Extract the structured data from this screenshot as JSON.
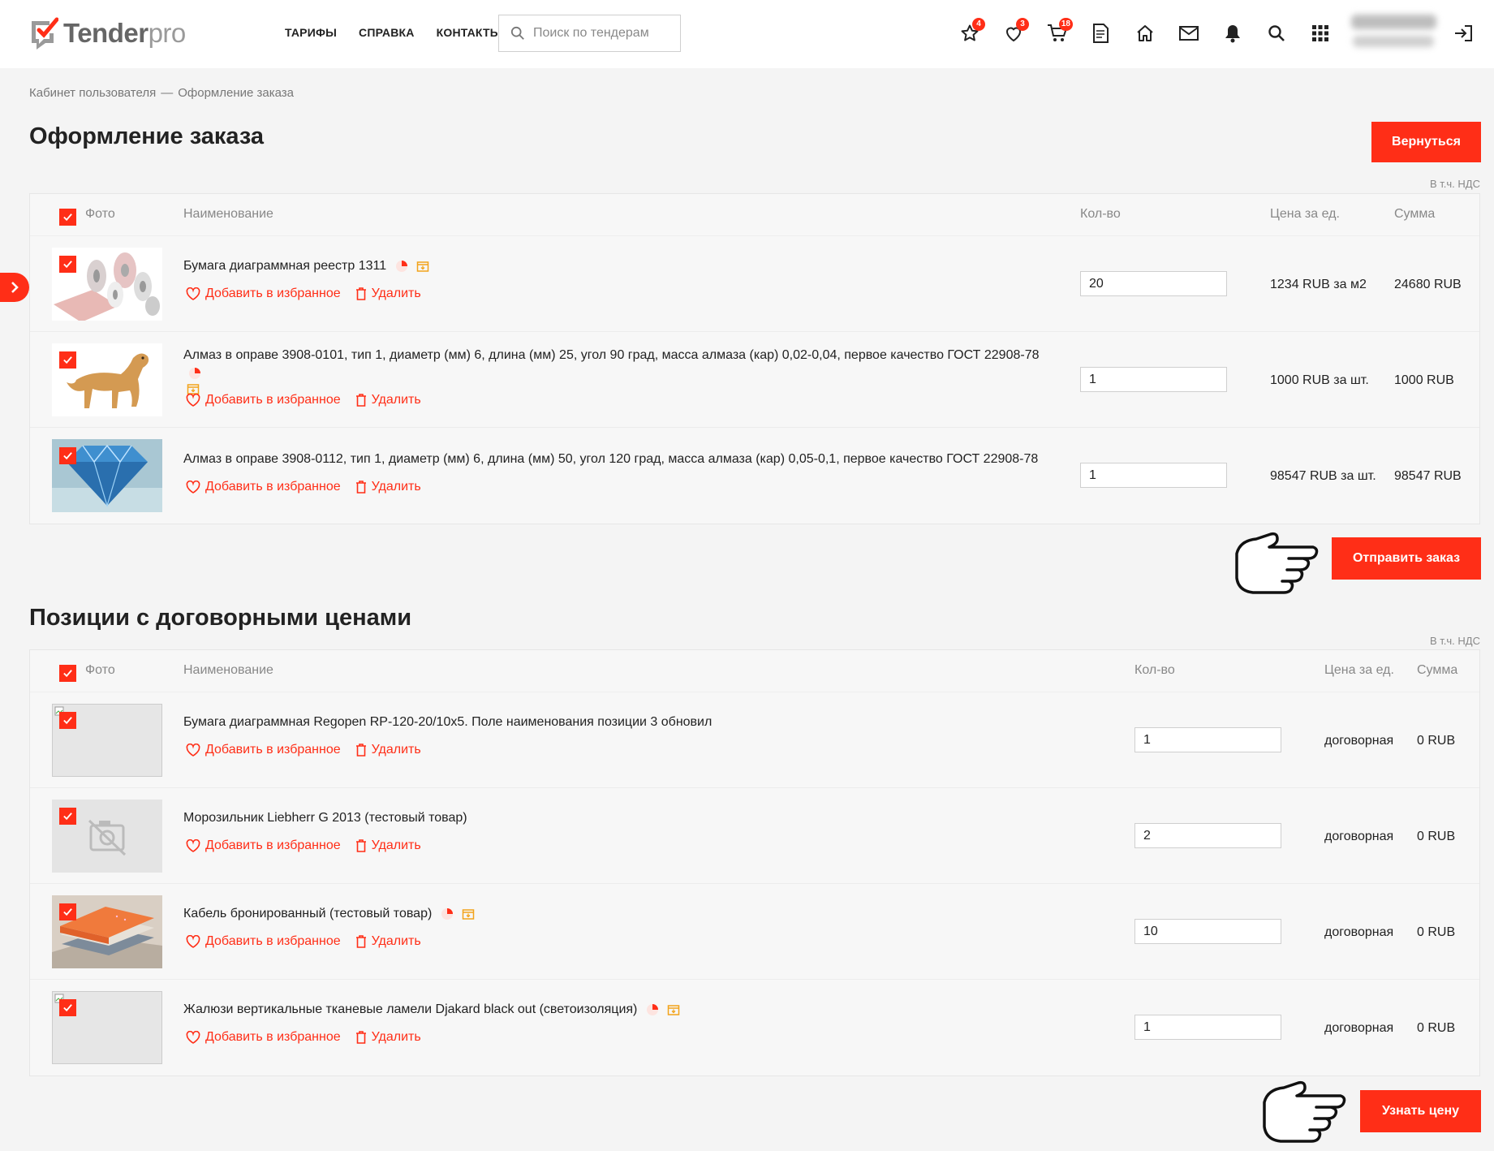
{
  "header": {
    "logo_main": "Tender",
    "logo_sub": "pro",
    "nav": [
      "ТАРИФЫ",
      "СПРАВКА",
      "КОНТАКТЫ"
    ],
    "search_placeholder": "Поиск по тендерам",
    "icons": [
      {
        "name": "star-icon",
        "badge": "4"
      },
      {
        "name": "heart-icon",
        "badge": "3"
      },
      {
        "name": "cart-icon",
        "badge": "18"
      },
      {
        "name": "document-icon",
        "badge": ""
      },
      {
        "name": "home-icon",
        "badge": ""
      },
      {
        "name": "mail-icon",
        "badge": ""
      },
      {
        "name": "bell-icon",
        "badge": ""
      },
      {
        "name": "search-icon",
        "badge": ""
      },
      {
        "name": "apps-grid-icon",
        "badge": ""
      },
      {
        "name": "logout-icon",
        "badge": ""
      }
    ]
  },
  "breadcrumb": {
    "parent": "Кабинет пользователя",
    "sep": "—",
    "current": "Оформление заказа"
  },
  "order": {
    "title": "Оформление заказа",
    "back_label": "Вернуться",
    "vat": "В т.ч. НДС",
    "headers": {
      "photo": "Фото",
      "name": "Наименование",
      "qty": "Кол-во",
      "price": "Цена за ед.",
      "sum": "Сумма"
    },
    "rows": [
      {
        "name": "Бумага диаграммная реестр 1311",
        "qty": "20",
        "price": "1234 RUB за м2",
        "sum": "24680 RUB"
      },
      {
        "name": "Алмаз в оправе 3908-0101, тип 1, диаметр (мм) 6, длина (мм) 25, угол 90 град, масса алмаза (кар) 0,02-0,04, первое качество ГОСТ 22908-78",
        "qty": "1",
        "price": "1000 RUB за шт.",
        "sum": "1000 RUB"
      },
      {
        "name": "Алмаз в оправе 3908-0112, тип 1, диаметр (мм) 6, длина (мм) 50, угол 120 град, масса алмаза (кар) 0,05-0,1, первое качество ГОСТ 22908-78",
        "qty": "1",
        "price": "98547 RUB за шт.",
        "sum": "98547 RUB"
      }
    ],
    "submit_label": "Отправить заказ"
  },
  "contract": {
    "title": "Позиции с договорными ценами",
    "vat": "В т.ч. НДС",
    "headers": {
      "photo": "Фото",
      "name": "Наименование",
      "qty": "Кол-во",
      "price": "Цена за ед.",
      "sum": "Сумма"
    },
    "rows": [
      {
        "name": "Бумага диаграммная Regopen RP-120-20/10x5. Поле наименования позиции 3 обновил",
        "qty": "1",
        "price": "договорная",
        "sum": "0 RUB"
      },
      {
        "name": "Морозильник Liebherr G 2013 (тестовый товар)",
        "qty": "2",
        "price": "договорная",
        "sum": "0 RUB"
      },
      {
        "name": "Кабель бронированный (тестовый товар)",
        "qty": "10",
        "price": "договорная",
        "sum": "0 RUB"
      },
      {
        "name": "Жалюзи вертикальные тканевые ламели Djakard black out (светоизоляция)",
        "qty": "1",
        "price": "договорная",
        "sum": "0 RUB"
      }
    ],
    "price_label": "Узнать цену"
  },
  "actions": {
    "favorite": "Добавить в избранное",
    "delete": "Удалить"
  },
  "colors": {
    "accent": "#ff2e17",
    "background": "#f4f4f4"
  }
}
